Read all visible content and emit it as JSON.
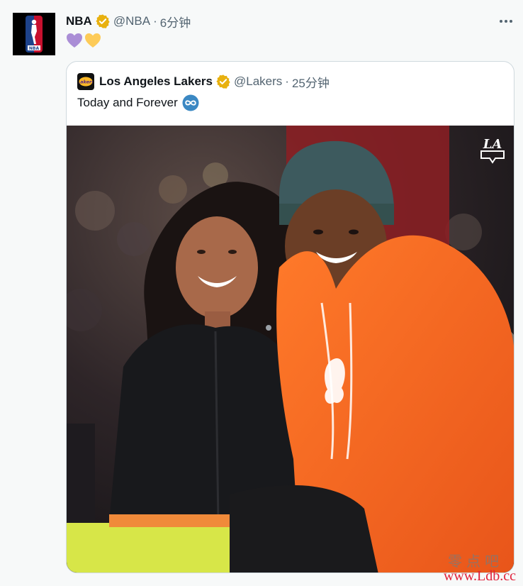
{
  "tweet": {
    "author_name": "NBA",
    "handle": "@NBA",
    "separator": "·",
    "time": "6分钟",
    "avatar_icon": "nba-logo-icon",
    "emojis": [
      "purple-heart",
      "yellow-heart"
    ],
    "more_icon": "more-options-icon"
  },
  "quote": {
    "author_name": "Los Angeles Lakers",
    "handle": "@Lakers",
    "separator": "·",
    "time": "25分钟",
    "text": "Today and Forever",
    "text_emoji": "infinity-icon",
    "avatar_icon": "lakers-logo-icon",
    "photo_corner_mark": "LA"
  },
  "watermark": {
    "chinese": "零点吧",
    "url": "www.Ldb.cc"
  },
  "colors": {
    "verified": "#e8b10f",
    "secondary_text": "#536471",
    "border": "#cfd9de",
    "purple_heart": "#aa8ed6",
    "yellow_heart": "#fdcb58",
    "infinity_blue": "#3b88c3",
    "hoodie_orange": "#f46b1e",
    "beanie_teal": "#3d5a5e",
    "watermark_red": "#e0203a"
  }
}
